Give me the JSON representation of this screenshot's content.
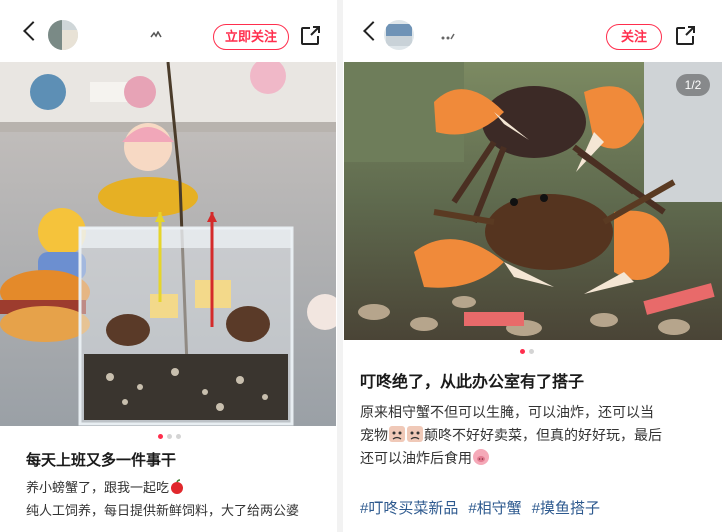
{
  "left_post": {
    "follow_label": "立即关注",
    "title": "每天上班又多一件事干",
    "lines": [
      "养小螃蟹了，跟我一起吃",
      "纯人工饲养，每日提供新鲜饲料，大了给两公婆"
    ],
    "emoji": "apple-emoji",
    "dot_count": 3,
    "active_dot": 1
  },
  "right_post": {
    "follow_label": "关注",
    "page_indicator": "1/2",
    "title": "叮咚绝了，从此办公室有了搭子",
    "line1": "原来相守蟹不但可以生腌，可以油炸，还可以当",
    "line2_a": "宠物",
    "line2_b": "颠咚不好好卖菜，但真的好好玩，最后",
    "line3": "还可以油炸后食用",
    "emoji_faces": [
      "sad-face-emoji",
      "sad-face-emoji",
      "pig-face-emoji"
    ],
    "tags": [
      "#叮咚买菜新品",
      "#相守蟹",
      "#摸鱼搭子"
    ],
    "dot_count": 2,
    "active_dot": 1
  },
  "colors": {
    "accent": "#ff2e4d",
    "tag": "#2e5a8f"
  },
  "icons": [
    "back-arrow-icon",
    "share-icon"
  ]
}
